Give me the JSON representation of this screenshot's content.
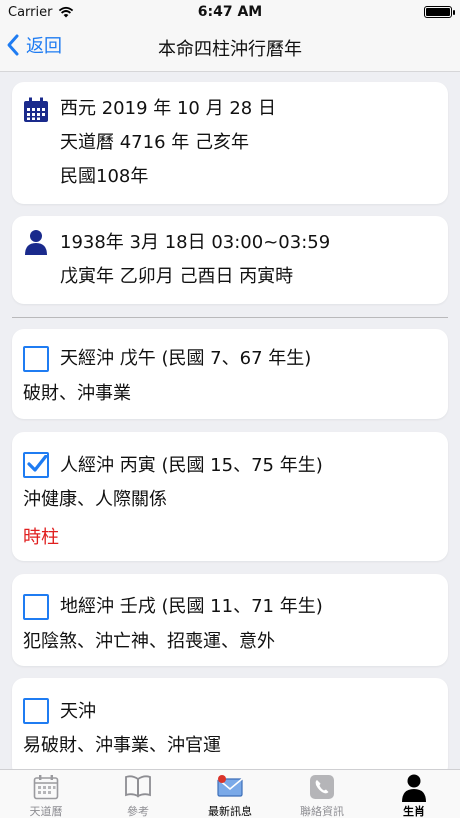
{
  "status": {
    "carrier": "Carrier",
    "time": "6:47 AM"
  },
  "nav": {
    "back_label": "返回",
    "title": "本命四柱沖行曆年"
  },
  "date_card": {
    "line1": "西元 2019 年 10 月 28 日",
    "line2": "天道曆 4716 年 己亥年",
    "line3": "民國108年"
  },
  "person_card": {
    "line1": "1938年 3月 18日 03:00~03:59",
    "line2": "戊寅年 乙卯月 己酉日 丙寅時"
  },
  "items": [
    {
      "title": "天經沖 戊午 (民國 7、67 年生)",
      "desc": "破財、沖事業",
      "note": "",
      "checked": false
    },
    {
      "title": "人經沖 丙寅 (民國 15、75 年生)",
      "desc": "沖健康、人際關係",
      "note": "時柱",
      "checked": true
    },
    {
      "title": "地經沖 壬戌 (民國 11、71 年生)",
      "desc": "犯陰煞、沖亡神、招喪運、意外",
      "note": "",
      "checked": false
    },
    {
      "title": "天沖",
      "desc": "易破財、沖事業、沖官運",
      "note": "",
      "checked": false
    }
  ],
  "tabs": [
    {
      "label": "天道曆",
      "icon": "calendar-icon"
    },
    {
      "label": "參考",
      "icon": "book-icon"
    },
    {
      "label": "最新訊息",
      "icon": "mail-icon"
    },
    {
      "label": "聯絡資訊",
      "icon": "phone-icon"
    },
    {
      "label": "生肖",
      "icon": "person-icon"
    }
  ],
  "colors": {
    "accent": "#1f7cf2",
    "navy": "#1a2a8c",
    "note_red": "#e01f1f"
  }
}
